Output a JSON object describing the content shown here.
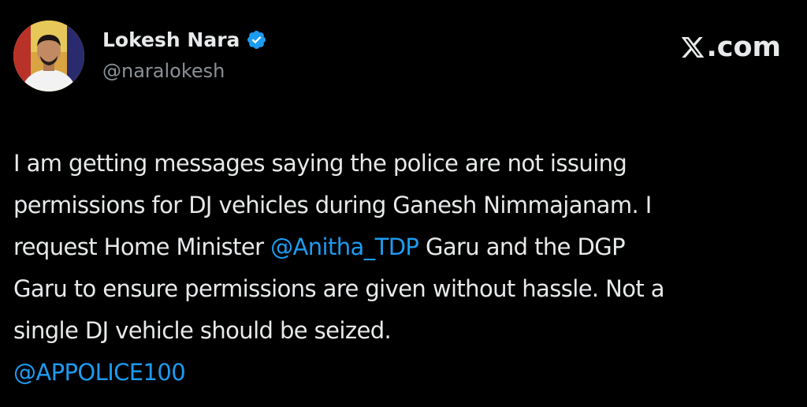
{
  "header": {
    "display_name": "Lokesh Nara",
    "verified_icon": "verified-badge-icon",
    "handle": "@naralokesh",
    "site_label": ".com",
    "site_logo_icon": "x-logo-icon",
    "avatar_icon": "profile-avatar"
  },
  "tweet": {
    "line1": "I am getting messages saying the police are not issuing",
    "line2": "permissions for DJ vehicles during Ganesh Nimmajanam. I",
    "line3_pre": "request Home Minister ",
    "line3_mention": "@Anitha_TDP",
    "line3_post": " Garu and the DGP",
    "line4": "Garu to ensure permissions are given without hassle. Not a",
    "line5": "single DJ vehicle should be seized.",
    "line6_mention": "@APPOLICE100"
  },
  "colors": {
    "background": "#000000",
    "text": "#e7e9ea",
    "secondary_text": "#8b9096",
    "mention": "#1d9bf0",
    "verified": "#1d9bf0"
  }
}
